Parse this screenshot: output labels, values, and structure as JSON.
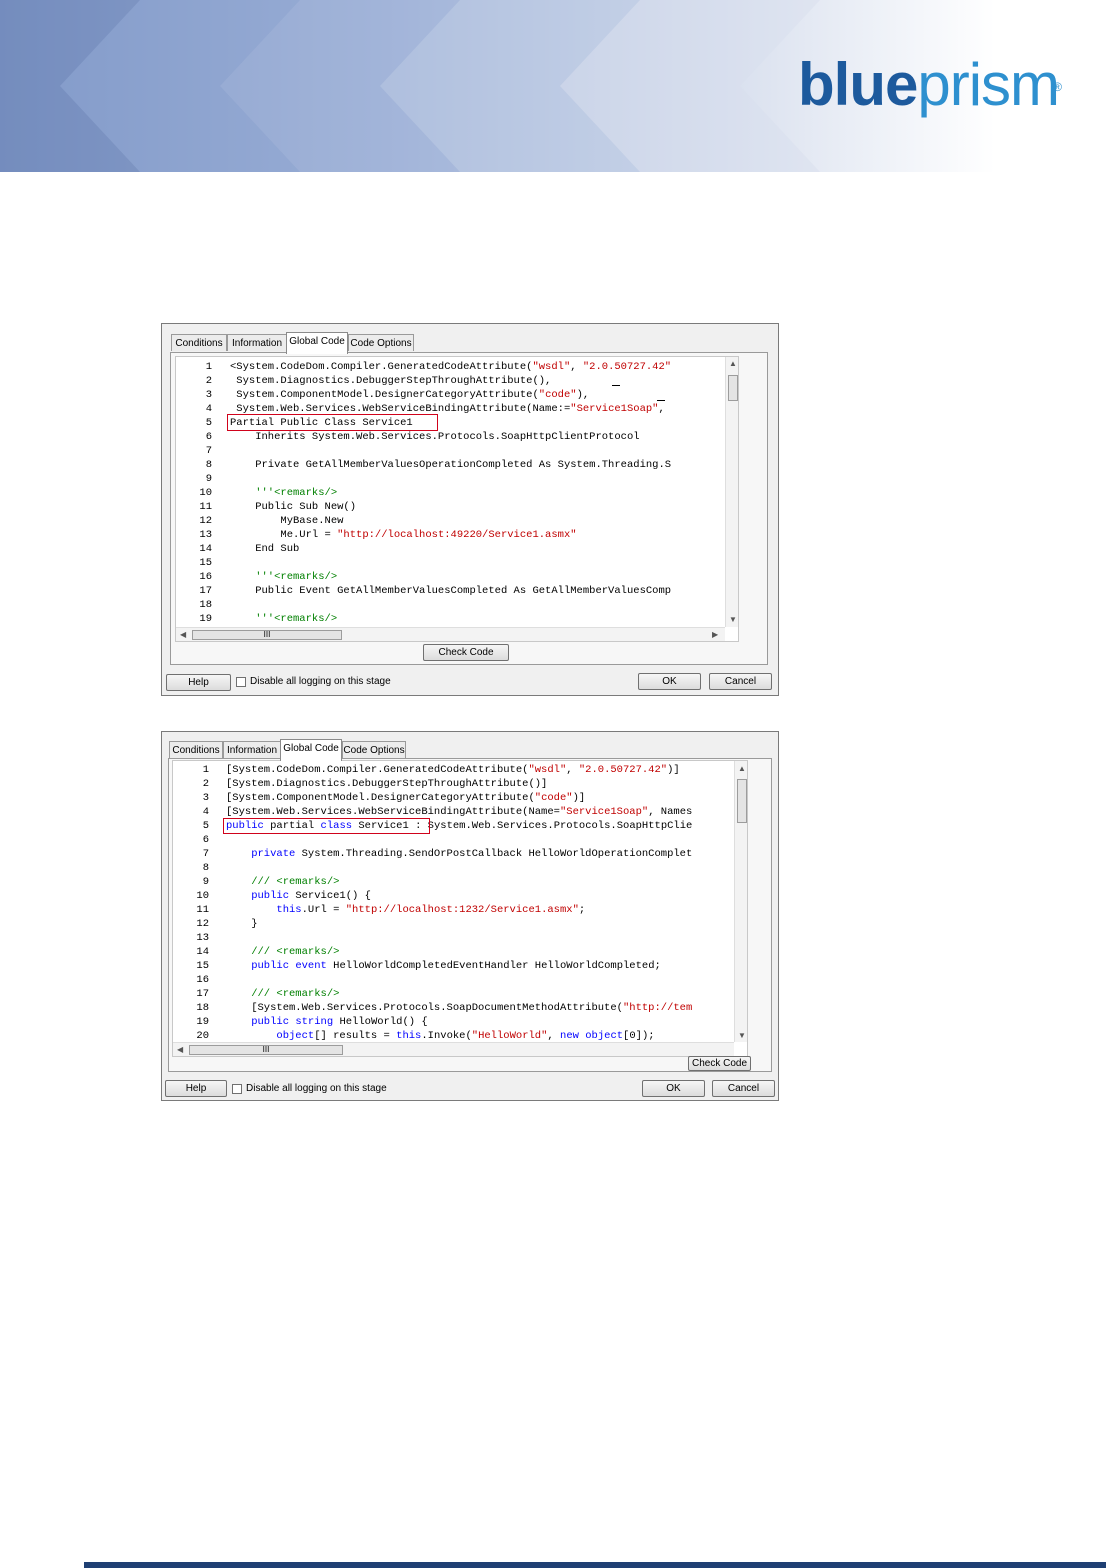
{
  "brand": {
    "logo_bold": "blue",
    "logo_light": "prism",
    "registered_mark": "®"
  },
  "colors": {
    "keyword": "#0000ff",
    "string": "#c00000",
    "comment": "#008000",
    "highlight_box": "#d0021b",
    "footer_bar": "#1f3f73"
  },
  "dialog_vb": {
    "tabs": [
      "Conditions",
      "Information",
      "Global Code",
      "Code Options"
    ],
    "active_tab": "Global Code",
    "line_numbers": [
      "1",
      "2",
      "3",
      "4",
      "5",
      "6",
      "7",
      "8",
      "9",
      "10",
      "11",
      "12",
      "13",
      "14",
      "15",
      "16",
      "17",
      "18",
      "19"
    ],
    "check_code_label": "Check Code",
    "help_label": "Help",
    "logging_label": "Disable all logging on this stage",
    "logging_checked": false,
    "ok_label": "OK",
    "cancel_label": "Cancel",
    "hscroll_thumb": "III"
  },
  "dialog_cs": {
    "tabs": [
      "Conditions",
      "Information",
      "Global Code",
      "Code Options"
    ],
    "active_tab": "Global Code",
    "line_numbers": [
      "1",
      "2",
      "3",
      "4",
      "5",
      "6",
      "7",
      "8",
      "9",
      "10",
      "11",
      "12",
      "13",
      "14",
      "15",
      "16",
      "17",
      "18",
      "19",
      "20"
    ],
    "check_code_label": "Check Code",
    "help_label": "Help",
    "logging_label": "Disable all logging on this stage",
    "logging_checked": false,
    "ok_label": "OK",
    "cancel_label": "Cancel",
    "hscroll_thumb": "III"
  },
  "vb_code": {
    "l1_a": "<System.CodeDom.Compiler.GeneratedCodeAttribute(",
    "l1_b": "\"wsdl\"",
    "l1_c": ", ",
    "l1_d": "\"2.0.50727.42\"",
    "l2": " System.Diagnostics.DebuggerStepThroughAttribute(),",
    "l3_a": " System.ComponentModel.DesignerCategoryAttribute(",
    "l3_b": "\"code\"",
    "l3_c": "),",
    "l4_a": " System.Web.Services.WebServiceBindingAttribute(Name:=",
    "l4_b": "\"Service1Soap\"",
    "l4_c": ",",
    "l5": "Partial Public Class Service1",
    "l6": "    Inherits System.Web.Services.Protocols.SoapHttpClientProtocol",
    "l8": "    Private GetAllMemberValuesOperationCompleted As System.Threading.S",
    "l10": "    '''<remarks/>",
    "l11": "    Public Sub New()",
    "l12": "        MyBase.New",
    "l13_a": "        Me.Url = ",
    "l13_b": "\"http://localhost:49220/Service1.asmx\"",
    "l14": "    End Sub",
    "l16": "    '''<remarks/>",
    "l17": "    Public Event GetAllMemberValuesCompleted As GetAllMemberValuesComp",
    "l19": "    '''<remarks/>"
  },
  "cs_code": {
    "l1_a": "[System.CodeDom.Compiler.GeneratedCodeAttribute(",
    "l1_b": "\"wsdl\"",
    "l1_c": ", ",
    "l1_d": "\"2.0.50727.42\"",
    "l1_e": ")]",
    "l2": "[System.Diagnostics.DebuggerStepThroughAttribute()]",
    "l3_a": "[System.ComponentModel.DesignerCategoryAttribute(",
    "l3_b": "\"code\"",
    "l3_c": ")]",
    "l4_a": "[System.Web.Services.WebServiceBindingAttribute(Name=",
    "l4_b": "\"Service1Soap\"",
    "l4_c": ", Names",
    "l5_k1": "public",
    "l5_sp1": " ",
    "l5_k2": "partial",
    "l5_sp2": " ",
    "l5_k3": "class",
    "l5_name": " Service1 ",
    "l5_rest": ": System.Web.Services.Protocols.SoapHttpClie",
    "l7_k": "    private",
    "l7_rest": " System.Threading.SendOrPostCallback HelloWorldOperationComplet",
    "l9": "    /// <remarks/>",
    "l10_k": "    public",
    "l10_rest": " Service1() {",
    "l11_k": "        this",
    "l11_a": ".Url = ",
    "l11_s": "\"http://localhost:1232/Service1.asmx\"",
    "l11_e": ";",
    "l12": "    }",
    "l14": "    /// <remarks/>",
    "l15_k1": "    public",
    "l15_sp": " ",
    "l15_k2": "event",
    "l15_rest": " HelloWorldCompletedEventHandler HelloWorldCompleted;",
    "l17": "    /// <remarks/>",
    "l18_a": "    [System.Web.Services.Protocols.SoapDocumentMethodAttribute(",
    "l18_s": "\"http://tem",
    "l19_k1": "    public",
    "l19_sp": " ",
    "l19_k2": "string",
    "l19_rest": " HelloWorld() {",
    "l20_k1": "        object",
    "l20_a": "[] results = ",
    "l20_k2": "this",
    "l20_b": ".Invoke(",
    "l20_s": "\"HelloWorld\"",
    "l20_c": ", ",
    "l20_k3": "new",
    "l20_d": " ",
    "l20_k4": "object",
    "l20_e": "[0]);"
  }
}
